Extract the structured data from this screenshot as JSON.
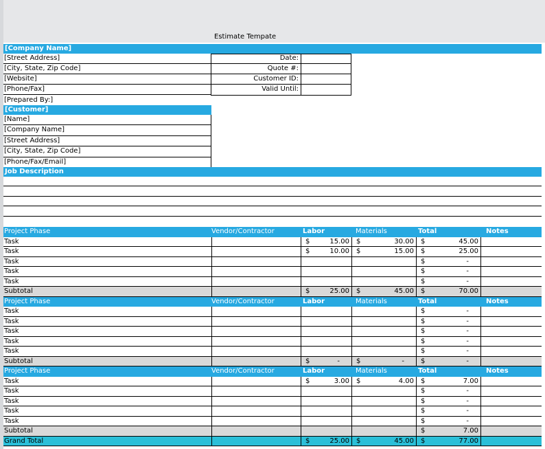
{
  "title": "Estimate Tempate",
  "company": {
    "header": "[Company Name]",
    "lines": [
      "[Street Address]",
      "[City, State, Zip Code]",
      "[Website]",
      "[Phone/Fax]",
      "[Prepared By:]"
    ]
  },
  "quote": {
    "labels": [
      "Date:",
      "Quote #:",
      "Customer ID:",
      "Valid Until:"
    ]
  },
  "customer": {
    "header": "[Customer]",
    "lines": [
      "[Name]",
      "[Company Name]",
      "[Street Address]",
      "[City, State, Zip Code]",
      "[Phone/Fax/Email]"
    ]
  },
  "job": {
    "header": "Job Description"
  },
  "table_header": {
    "phase": "Project Phase",
    "vendor": "Vendor/Contractor",
    "labor": "Labor",
    "materials": "Materials",
    "total": "Total",
    "notes": "Notes"
  },
  "currency": "$",
  "sections": [
    {
      "rows": [
        {
          "task": "Task",
          "labor": "15.00",
          "materials": "30.00",
          "total": "45.00"
        },
        {
          "task": "Task",
          "labor": "10.00",
          "materials": "15.00",
          "total": "25.00"
        },
        {
          "task": "Task",
          "labor": "",
          "materials": "",
          "total": "-"
        },
        {
          "task": "Task",
          "labor": "",
          "materials": "",
          "total": "-"
        },
        {
          "task": "Task",
          "labor": "",
          "materials": "",
          "total": "-"
        }
      ],
      "subtotal": {
        "label": "Subtotal",
        "labor": "25.00",
        "materials": "45.00",
        "total": "70.00"
      }
    },
    {
      "rows": [
        {
          "task": "Task",
          "labor": "",
          "materials": "",
          "total": "-"
        },
        {
          "task": "Task",
          "labor": "",
          "materials": "",
          "total": "-"
        },
        {
          "task": "Task",
          "labor": "",
          "materials": "",
          "total": "-"
        },
        {
          "task": "Task",
          "labor": "",
          "materials": "",
          "total": "-"
        },
        {
          "task": "Task",
          "labor": "",
          "materials": "",
          "total": "-"
        }
      ],
      "subtotal": {
        "label": "Subtotal",
        "labor": "-",
        "materials": "-",
        "total": "-"
      }
    },
    {
      "rows": [
        {
          "task": "Task",
          "labor": "3.00",
          "materials": "4.00",
          "total": "7.00"
        },
        {
          "task": "Task",
          "labor": "",
          "materials": "",
          "total": "-"
        },
        {
          "task": "Task",
          "labor": "",
          "materials": "",
          "total": "-"
        },
        {
          "task": "Task",
          "labor": "",
          "materials": "",
          "total": "-"
        },
        {
          "task": "Task",
          "labor": "",
          "materials": "",
          "total": "-"
        }
      ],
      "subtotal": {
        "label": "Subtotal",
        "labor": "",
        "materials": "",
        "total": "7.00"
      }
    }
  ],
  "grand_total": {
    "label": "Grand Total",
    "labor": "25.00",
    "materials": "45.00",
    "total": "77.00"
  },
  "colors": {
    "band": "#27a9e1",
    "grand": "#2bbfd8",
    "subtotal": "#d9d9d9",
    "top_area": "#e6e7e9"
  }
}
